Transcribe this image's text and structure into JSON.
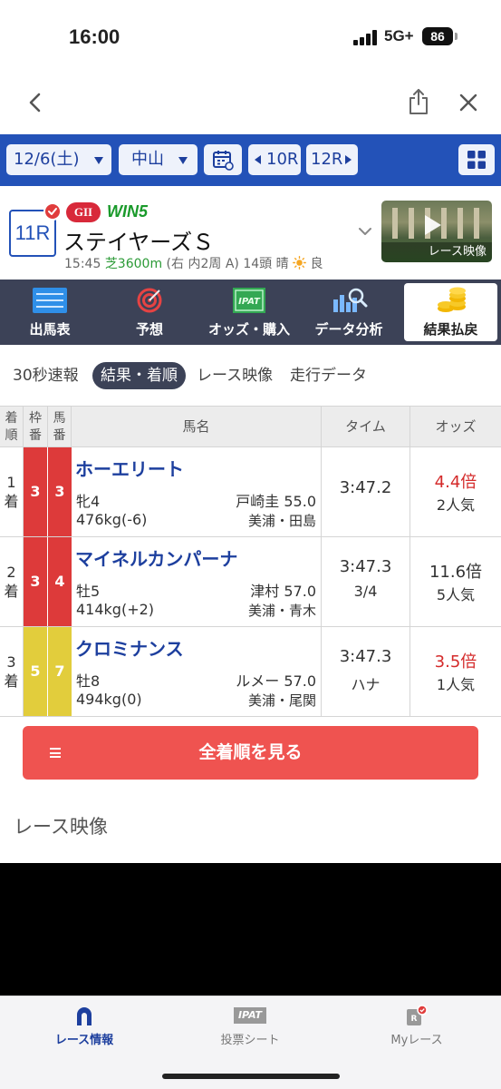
{
  "status_bar": {
    "time": "16:00",
    "network": "5G+",
    "battery": "86"
  },
  "browser_nav": {
    "back_icon": "chevron-left-icon",
    "share_icon": "share-icon",
    "close_icon": "close-icon"
  },
  "date_bar": {
    "date": "12/6(土)",
    "venue": "中山",
    "prev_race": "10R",
    "next_race": "12R",
    "calendar_icon": "calendar-icon",
    "grid_icon": "grid-icon",
    "background": "#2352b8"
  },
  "race": {
    "number": "11R",
    "grade": "GII",
    "win5": "WIN5",
    "name": "ステイヤーズＳ",
    "start_time": "15:45",
    "course": "芝3600m",
    "course_detail": "(右 内2周 A)",
    "runners": "14頭",
    "weather": "晴",
    "track_condition": "良",
    "video_label": "レース映像"
  },
  "menu": {
    "items": [
      {
        "label": "出馬表",
        "icon": "list-icon"
      },
      {
        "label": "予想",
        "icon": "target-icon"
      },
      {
        "label": "オッズ・購入",
        "icon": "ipat-icon"
      },
      {
        "label": "データ分析",
        "icon": "chart-search-icon"
      },
      {
        "label": "結果払戻",
        "icon": "coins-icon"
      }
    ],
    "active_index": 4
  },
  "sub_tabs": {
    "items": [
      "30秒速報",
      "結果・着順",
      "レース映像",
      "走行データ"
    ],
    "active_index": 1
  },
  "results_table": {
    "headers": {
      "rank": "着順",
      "waku": "枠番",
      "uma": "馬番",
      "horse": "馬名",
      "time": "タイム",
      "odds": "オッズ"
    },
    "rows": [
      {
        "rank": "1着",
        "waku": "3",
        "uma": "3",
        "color": "red",
        "name": "ホーエリート",
        "sex_age": "牝4",
        "jockey": "戸崎圭 55.0",
        "weight": "476kg(-6)",
        "trainer": "美浦・田島",
        "time": "3:47.2",
        "margin": "",
        "odds": "4.4倍",
        "odds_hot": true,
        "popularity": "2人気"
      },
      {
        "rank": "2着",
        "waku": "3",
        "uma": "4",
        "color": "red",
        "name": "マイネルカンパーナ",
        "sex_age": "牡5",
        "jockey": "津村 57.0",
        "weight": "414kg(+2)",
        "trainer": "美浦・青木",
        "time": "3:47.3",
        "margin": "3/4",
        "odds": "11.6倍",
        "odds_hot": false,
        "popularity": "5人気"
      },
      {
        "rank": "3着",
        "waku": "5",
        "uma": "7",
        "color": "yellow",
        "name": "クロミナンス",
        "sex_age": "牡8",
        "jockey": "ルメー 57.0",
        "weight": "494kg(0)",
        "trainer": "美浦・尾関",
        "time": "3:47.3",
        "margin": "ハナ",
        "odds": "3.5倍",
        "odds_hot": true,
        "popularity": "1人気"
      }
    ]
  },
  "all_results_button": "全着順を見る",
  "video_section_title": "レース映像",
  "bottom_nav": {
    "items": [
      {
        "label": "レース情報",
        "icon": "horseshoe-icon"
      },
      {
        "label": "投票シート",
        "icon": "ipat-icon"
      },
      {
        "label": "Myレース",
        "icon": "my-race-icon"
      }
    ],
    "active_index": 0,
    "ipat_text": "IPAT"
  },
  "colors": {
    "accent_blue": "#2352b8",
    "menu_dark": "#3c4257",
    "button_red": "#ef5350",
    "waku_red": "#dd3a3a",
    "waku_yellow": "#e2cd3c"
  }
}
